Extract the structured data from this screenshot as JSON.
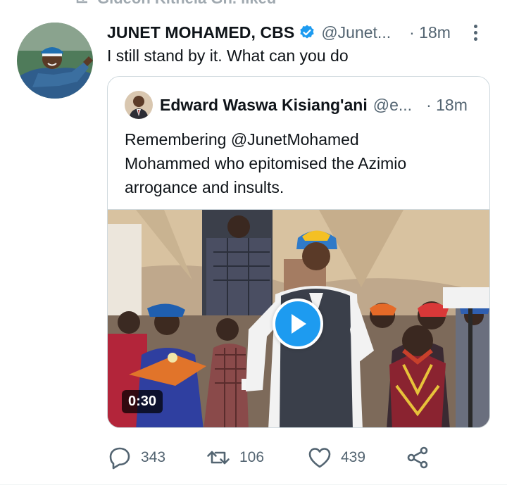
{
  "context": {
    "text": "Gideon Kithela Gh.    liked",
    "icon": "retweet-icon"
  },
  "tweet": {
    "author_name": "JUNET MOHAMED, CBS",
    "handle": "@Junet...",
    "time": "· 18m",
    "text": "I still stand by it. What can you do",
    "verified_icon": "verified-badge-icon",
    "more_icon": "more-options-icon"
  },
  "quote": {
    "author_name": "Edward Waswa Kisiang'ani",
    "handle": "@e...",
    "time": "· 18m",
    "text_lines": [
      "Remembering  @JunetMohamed",
      "Mohammed who epitomised  the Azimio",
      "arrogance and insults."
    ],
    "video": {
      "duration": "0:30",
      "play_icon": "play-icon"
    }
  },
  "actions": {
    "reply": {
      "icon": "reply-icon",
      "count": "343"
    },
    "retweet": {
      "icon": "retweet-icon",
      "count": "106"
    },
    "like": {
      "icon": "heart-icon",
      "count": "439"
    },
    "share": {
      "icon": "share-icon"
    }
  },
  "colors": {
    "accent": "#1d9bf0",
    "text_primary": "#0f1419",
    "text_secondary": "#536471",
    "border": "#cfd9de"
  }
}
